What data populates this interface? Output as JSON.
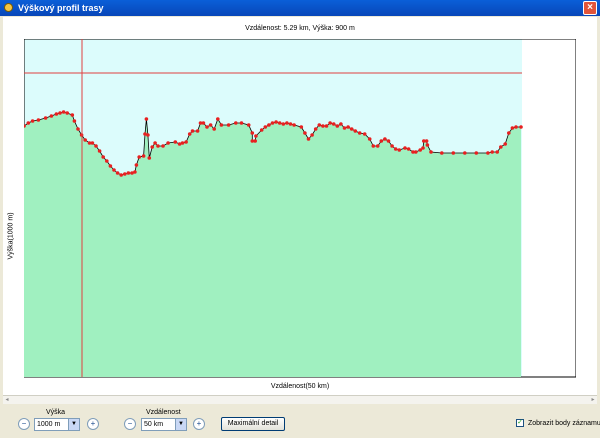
{
  "window": {
    "title": "Výškový profil trasy",
    "close_glyph": "×"
  },
  "info_text": "Vzdálenost: 5.29 km, Výška: 900 m",
  "chart_data": {
    "type": "area",
    "ylabel": "Výška(1000 m)",
    "xlabel": "Vzdálenost(50 km)",
    "colors": {
      "sky": "#dcfcfc",
      "terrain": "#a0f0c0",
      "line": "#000000",
      "points": "#e82020",
      "cursor": "#e04040"
    },
    "cursor": {
      "distance_km": 5.29,
      "elevation_m": 900
    },
    "profile": [
      [
        0.0,
        87
      ],
      [
        0.6,
        84
      ],
      [
        1.2,
        82
      ],
      [
        2.0,
        81
      ],
      [
        3.0,
        79
      ],
      [
        3.8,
        77
      ],
      [
        4.5,
        75
      ],
      [
        5.0,
        74
      ],
      [
        5.5,
        73
      ],
      [
        6.0,
        74
      ],
      [
        6.7,
        76
      ],
      [
        7.0,
        82
      ],
      [
        7.5,
        90
      ],
      [
        8.0,
        96
      ],
      [
        8.5,
        101
      ],
      [
        9.1,
        104
      ],
      [
        9.5,
        104
      ],
      [
        10.0,
        107
      ],
      [
        10.5,
        112
      ],
      [
        11.0,
        118
      ],
      [
        11.5,
        122
      ],
      [
        12.0,
        127
      ],
      [
        12.5,
        131
      ],
      [
        13.0,
        134
      ],
      [
        13.5,
        136
      ],
      [
        14.0,
        135
      ],
      [
        14.5,
        134
      ],
      [
        15.0,
        134
      ],
      [
        15.4,
        133
      ],
      [
        15.6,
        126
      ],
      [
        16.0,
        118
      ],
      [
        16.6,
        117
      ],
      [
        16.8,
        95
      ],
      [
        17.0,
        80
      ],
      [
        17.2,
        96
      ],
      [
        17.4,
        119
      ],
      [
        17.8,
        108
      ],
      [
        18.2,
        104
      ],
      [
        18.6,
        107
      ],
      [
        19.3,
        107
      ],
      [
        20.0,
        104
      ],
      [
        21.0,
        103
      ],
      [
        21.6,
        105
      ],
      [
        22.0,
        104
      ],
      [
        22.5,
        103
      ],
      [
        23.0,
        95
      ],
      [
        23.4,
        92
      ],
      [
        24.1,
        92
      ],
      [
        24.5,
        84
      ],
      [
        24.9,
        84
      ],
      [
        25.4,
        88
      ],
      [
        25.9,
        86
      ],
      [
        26.4,
        90
      ],
      [
        26.9,
        80
      ],
      [
        27.4,
        86
      ],
      [
        28.4,
        86
      ],
      [
        29.4,
        84
      ],
      [
        30.2,
        84
      ],
      [
        31.2,
        86
      ],
      [
        31.7,
        94
      ],
      [
        31.7,
        102
      ],
      [
        32.1,
        102
      ],
      [
        32.2,
        97
      ],
      [
        33.0,
        91
      ],
      [
        33.5,
        88
      ],
      [
        34.0,
        86
      ],
      [
        34.5,
        84
      ],
      [
        35.0,
        83
      ],
      [
        35.5,
        84
      ],
      [
        36.0,
        85
      ],
      [
        36.5,
        84
      ],
      [
        37.0,
        85
      ],
      [
        37.5,
        86
      ],
      [
        38.5,
        88
      ],
      [
        39.0,
        94
      ],
      [
        39.5,
        100
      ],
      [
        40.0,
        96
      ],
      [
        40.5,
        90
      ],
      [
        41.0,
        86
      ],
      [
        41.5,
        87
      ],
      [
        42.0,
        87
      ],
      [
        42.5,
        84
      ],
      [
        43.0,
        85
      ],
      [
        43.5,
        87
      ],
      [
        44.0,
        85
      ],
      [
        44.5,
        89
      ],
      [
        45.0,
        88
      ],
      [
        45.5,
        90
      ],
      [
        46.0,
        92
      ],
      [
        46.6,
        94
      ],
      [
        47.3,
        95
      ],
      [
        48.0,
        100
      ],
      [
        48.5,
        107
      ],
      [
        49.1,
        107
      ],
      [
        49.6,
        102
      ],
      [
        50.1,
        100
      ],
      [
        50.6,
        102
      ],
      [
        51.1,
        107
      ],
      [
        51.6,
        110
      ],
      [
        52.1,
        111
      ],
      [
        52.9,
        109
      ],
      [
        53.4,
        110
      ],
      [
        54.0,
        113
      ],
      [
        54.4,
        113
      ],
      [
        55.0,
        111
      ],
      [
        55.4,
        109
      ],
      [
        55.5,
        102
      ],
      [
        55.9,
        102
      ],
      [
        56.0,
        106
      ],
      [
        56.5,
        113
      ],
      [
        58.0,
        114
      ],
      [
        59.6,
        114
      ],
      [
        61.2,
        114
      ],
      [
        62.8,
        114
      ],
      [
        64.4,
        114
      ],
      [
        65.0,
        113
      ],
      [
        65.7,
        113
      ],
      [
        66.2,
        108
      ],
      [
        66.8,
        105
      ],
      [
        67.3,
        94
      ],
      [
        67.8,
        89
      ],
      [
        68.3,
        88
      ],
      [
        69.0,
        88
      ]
    ],
    "view": {
      "x_max_units": 73.56,
      "y_values_are_screen_offsets_from_top": false
    }
  },
  "toolbar": {
    "height_label": "Výška",
    "height_value": "1000 m",
    "distance_label": "Vzdálenost",
    "distance_value": "50 km",
    "max_detail_label": "Maximální detail",
    "show_points_label": "Zobrazit body záznamu",
    "show_points_checked": "✓",
    "zoom_out_glyph": "−",
    "zoom_in_glyph": "+",
    "arrow_glyph": "▼"
  },
  "scroll": {
    "left_glyph": "◂",
    "right_glyph": "▸"
  }
}
